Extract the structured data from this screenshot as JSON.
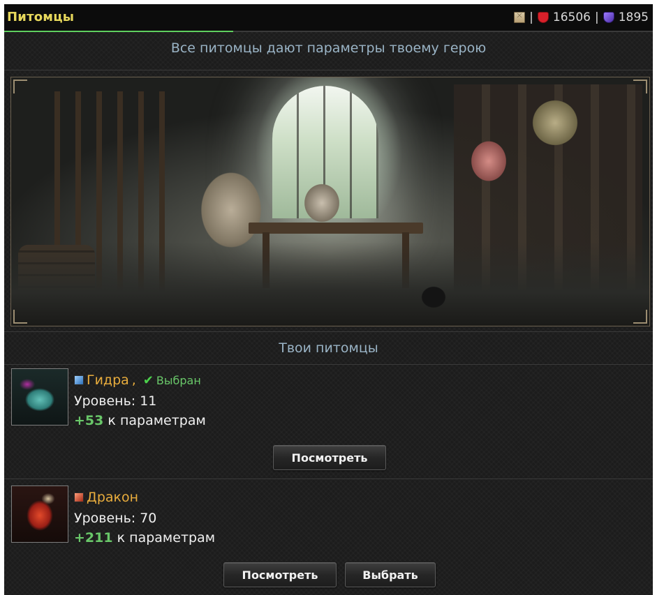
{
  "header": {
    "title": "Питомцы",
    "resources": {
      "mail_icon": "mail-icon",
      "separator": "|",
      "health_icon": "shield-icon",
      "health": "16506",
      "mana_icon": "gem-icon",
      "mana": "1895"
    },
    "accent_color": "#5fd05f"
  },
  "intro": {
    "text": "Все питомцы дают параметры твоему герою"
  },
  "scene": {
    "description_icon": "pet-shop-scene-image"
  },
  "pets_section": {
    "title": "Твои питомцы",
    "pets": [
      {
        "type_icon": "water-element-icon",
        "name": "Гидра",
        "comma": ",",
        "selected": true,
        "selected_label": "Выбран",
        "level_label": "Уровень:",
        "level": "11",
        "bonus": "+53",
        "bonus_suffix": "к параметрам",
        "buttons": {
          "view": "Посмотреть"
        }
      },
      {
        "type_icon": "fire-element-icon",
        "name": "Дракон",
        "selected": false,
        "level_label": "Уровень:",
        "level": "70",
        "bonus": "+211",
        "bonus_suffix": "к параметрам",
        "buttons": {
          "view": "Посмотреть",
          "select": "Выбрать"
        }
      }
    ]
  },
  "colors": {
    "title": "#e7d85c",
    "pet_name": "#e9ad3d",
    "bonus": "#69c769",
    "subtitle": "#9ab4c6"
  }
}
